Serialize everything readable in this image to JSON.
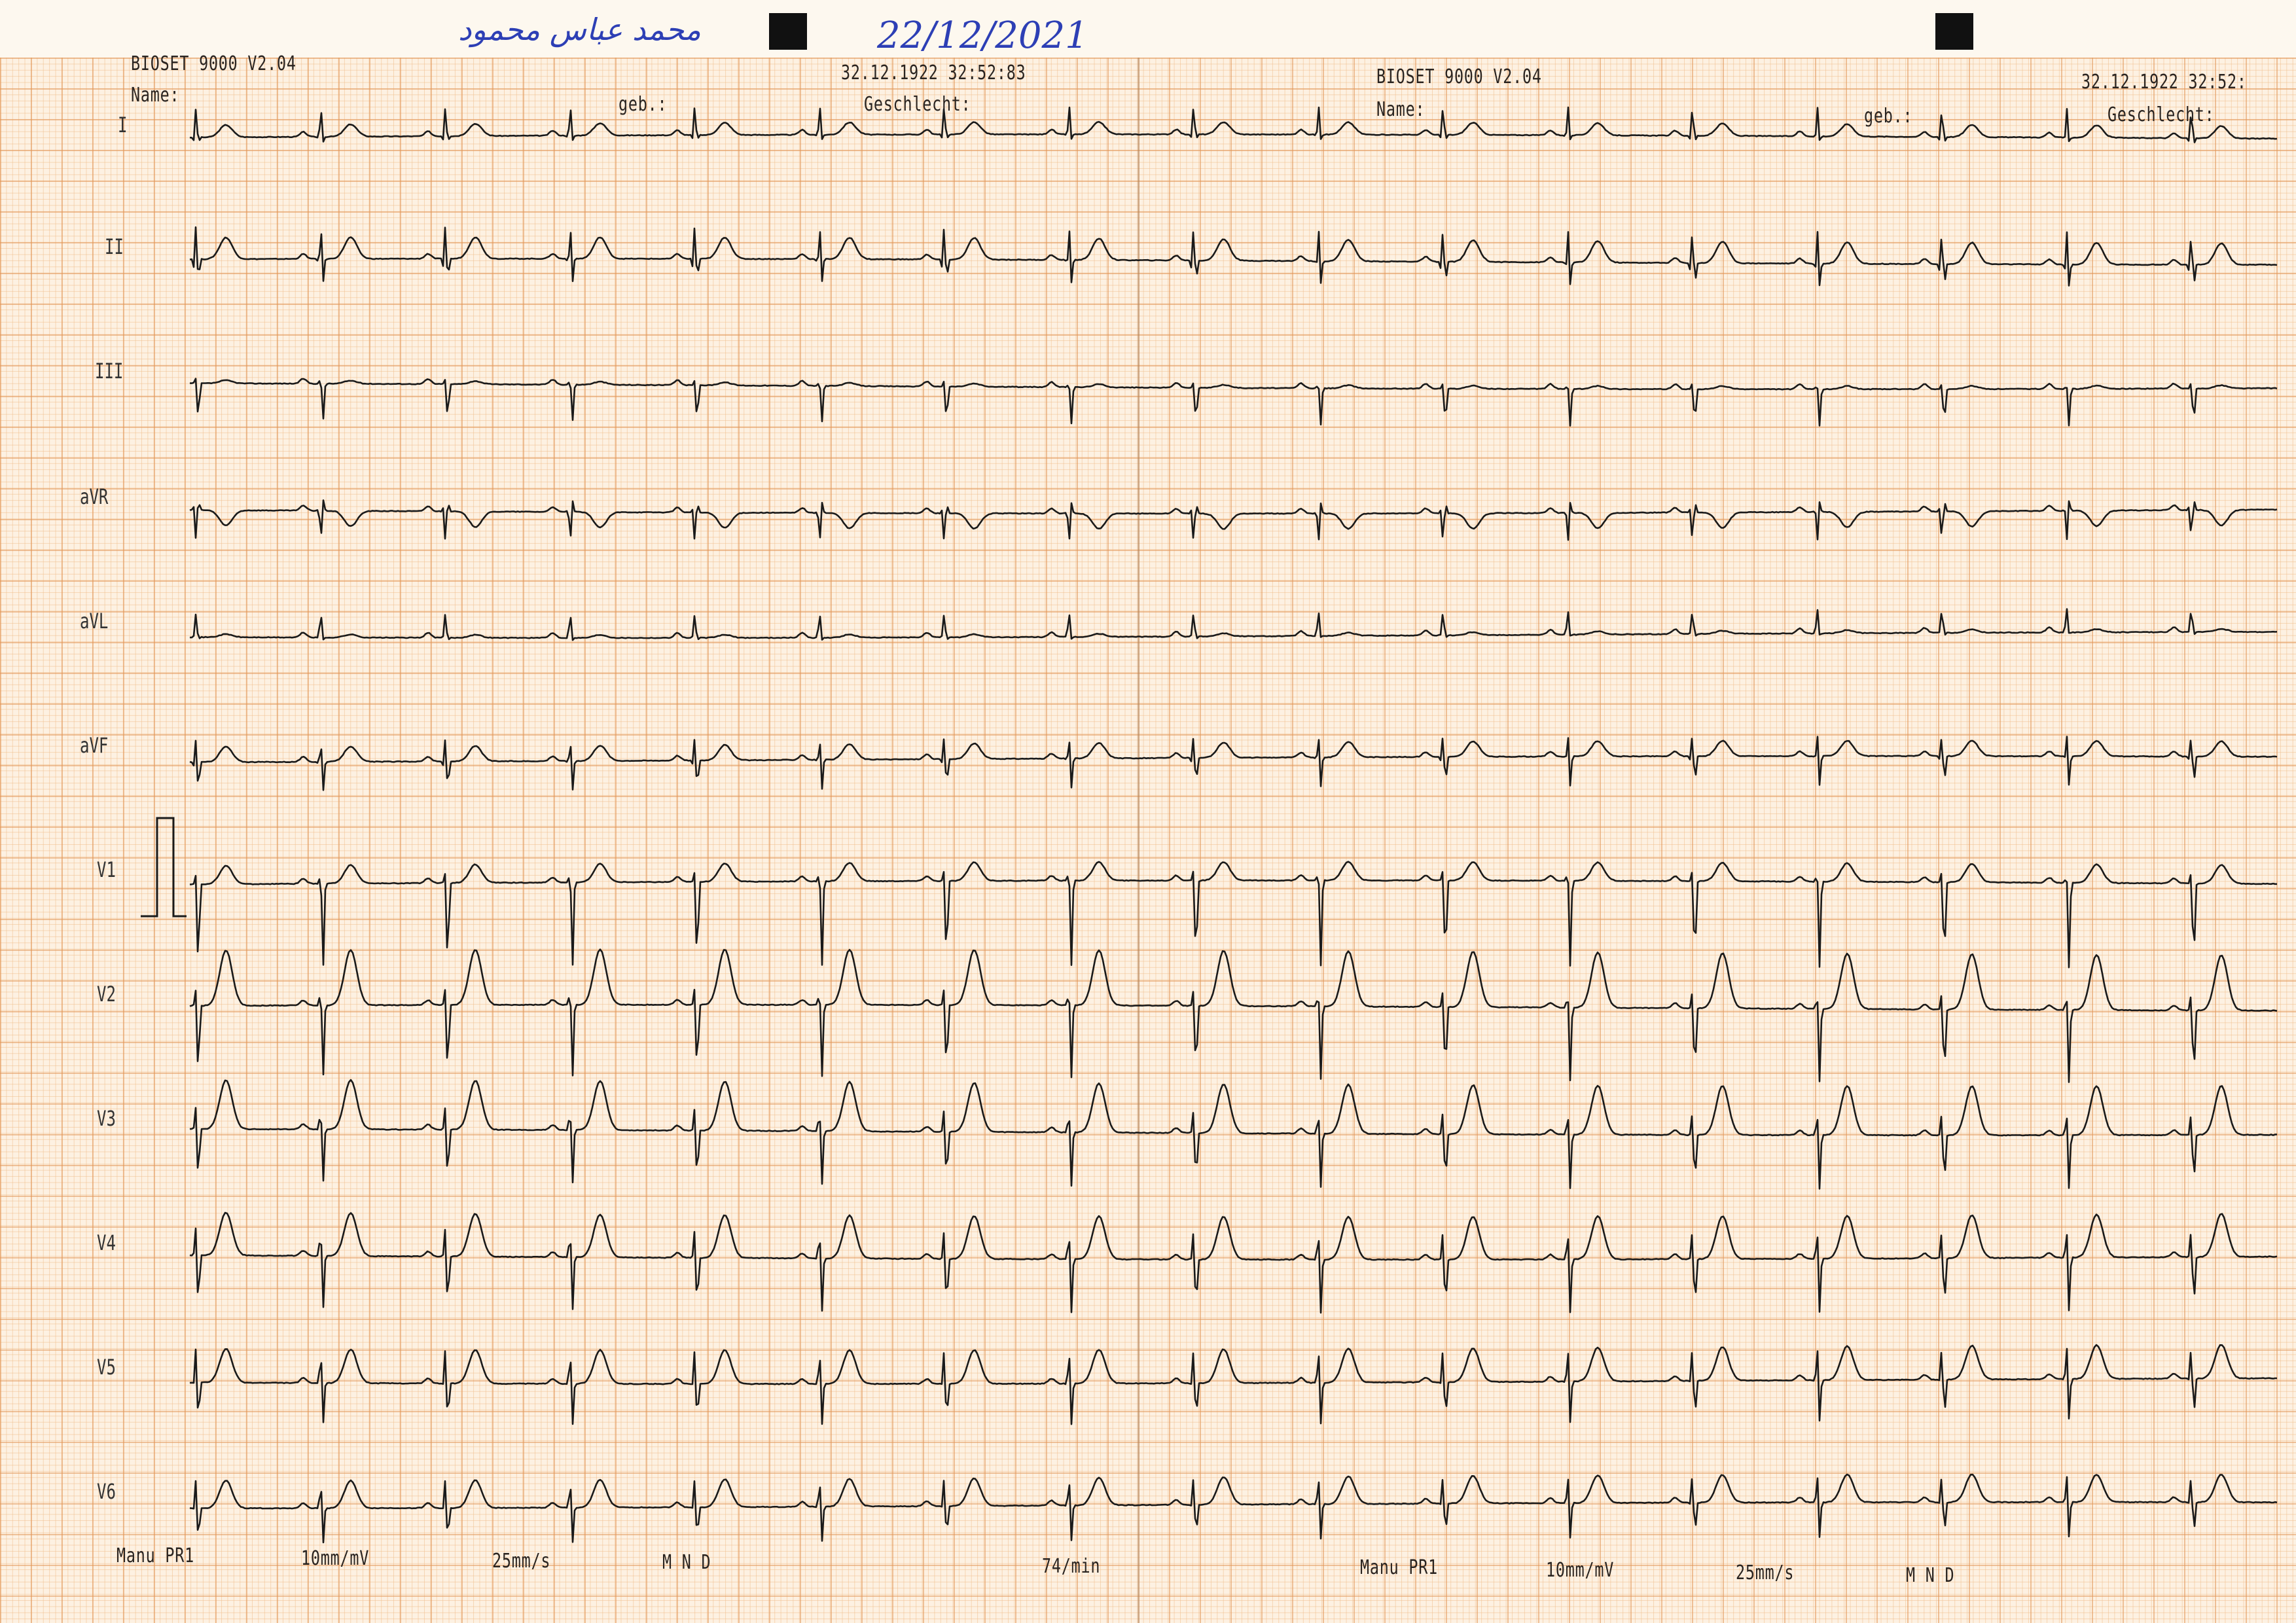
{
  "handwriting": {
    "name": "محمد عباس محمود",
    "date": "22/12/2021"
  },
  "panels": [
    {
      "device": "BIOSET 9000 V2.04",
      "name_label": "Name:",
      "geb_label": "geb.:",
      "datetime": "32.12.1922 32:52:83",
      "gender_label": "Geschlecht:",
      "footer": {
        "mode": "Manu PR1",
        "gain": "10mm/mV",
        "speed": "25mm/s",
        "filter": "M  N  D",
        "rate": "74/min"
      }
    },
    {
      "device": "BIOSET 9000 V2.04",
      "name_label": "Name:",
      "geb_label": "geb.:",
      "datetime": "32.12.1922 32:52:",
      "gender_label": "Geschlecht:",
      "footer": {
        "mode": "Manu PR1",
        "gain": "10mm/mV",
        "speed": "25mm/s",
        "filter": "M  N  D",
        "rate": ""
      }
    }
  ],
  "leads": [
    {
      "label": "I",
      "q": -0.1,
      "r": 0.5,
      "s": -0.1,
      "t": 0.2
    },
    {
      "label": "II",
      "q": -0.2,
      "r": 0.6,
      "s": -0.4,
      "t": 0.35
    },
    {
      "label": "III",
      "q": 0.0,
      "r": 0.1,
      "s": -0.6,
      "t": 0.05
    },
    {
      "label": "aVR",
      "q": 0.1,
      "r": -0.5,
      "s": 0.2,
      "t": -0.25
    },
    {
      "label": "aVL",
      "q": 0.0,
      "r": 0.4,
      "s": -0.05,
      "t": 0.05
    },
    {
      "label": "aVF",
      "q": -0.1,
      "r": 0.4,
      "s": -0.5,
      "t": 0.25
    },
    {
      "label": "V1",
      "q": 0.0,
      "r": 0.2,
      "s": -1.4,
      "t": 0.3
    },
    {
      "label": "V2",
      "q": 0.0,
      "r": 0.3,
      "s": -1.2,
      "t": 0.9
    },
    {
      "label": "V3",
      "q": 0.0,
      "r": 0.4,
      "s": -0.9,
      "t": 0.8
    },
    {
      "label": "V4",
      "q": 0.0,
      "r": 0.5,
      "s": -0.9,
      "t": 0.7
    },
    {
      "label": "V5",
      "q": -0.05,
      "r": 0.6,
      "s": -0.7,
      "t": 0.55
    },
    {
      "label": "V6",
      "q": -0.05,
      "r": 0.5,
      "s": -0.6,
      "t": 0.45
    }
  ],
  "heart_rate_bpm": 74,
  "paper_speed_mm_s": 25,
  "gain_mm_mv": 10,
  "colors": {
    "grid_major": "#e29658",
    "grid_minor": "#f0be8c",
    "paper": "#fdf1e2",
    "trace": "#1a1a1a",
    "ink": "#2d3fb5"
  }
}
